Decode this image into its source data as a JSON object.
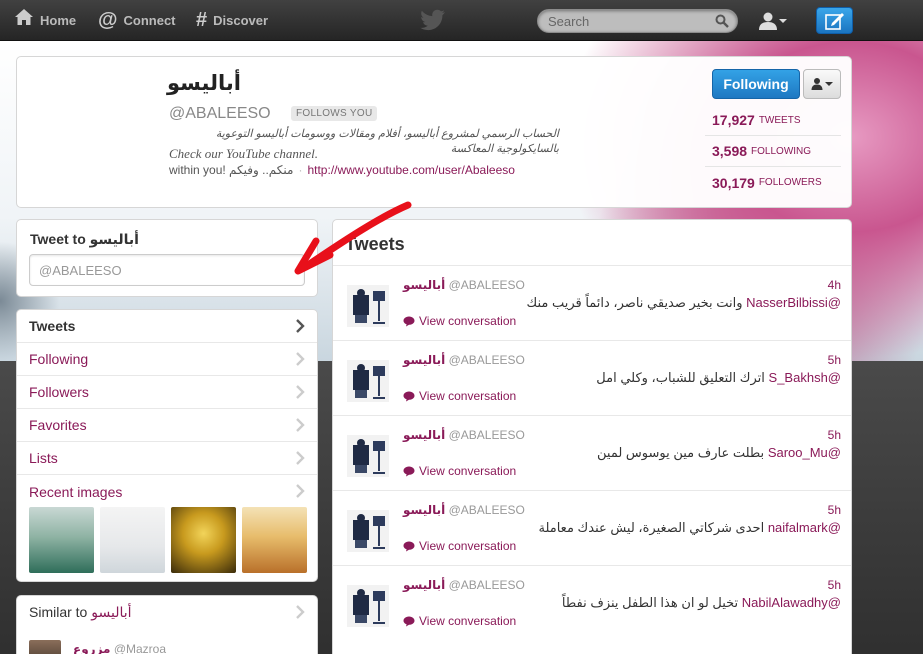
{
  "topbar": {
    "nav": [
      {
        "label": "Home",
        "icon": "home-icon"
      },
      {
        "label": "Connect",
        "icon": "at-icon"
      },
      {
        "label": "Discover",
        "icon": "hash-icon"
      }
    ],
    "search_placeholder": "Search"
  },
  "profile": {
    "name": "أباليسو",
    "handle": "@ABALEESO",
    "follows_you": "FOLLOWS YOU",
    "bio_arabic": "الحساب الرسمي لمشروع أباليسو، أفلام ومقالات ووسومات أباليسو التوعوية بالسايكولوجية المعاكسة",
    "bio_english": "Check our YouTube channel.",
    "location": "within you! منكم.. وفيكم",
    "url": "http://www.youtube.com/user/Abaleeso",
    "following_button": "Following",
    "stats": [
      {
        "num": "17,927",
        "label": "TWEETS"
      },
      {
        "num": "3,598",
        "label": "FOLLOWING"
      },
      {
        "num": "30,179",
        "label": "FOLLOWERS"
      }
    ]
  },
  "tweet_to": {
    "title": "Tweet to",
    "name": "أباليسو",
    "placeholder": "@ABALEESO"
  },
  "sidebar_nav": [
    {
      "label": "Tweets",
      "active": true
    },
    {
      "label": "Following",
      "active": false
    },
    {
      "label": "Followers",
      "active": false
    },
    {
      "label": "Favorites",
      "active": false
    },
    {
      "label": "Lists",
      "active": false
    },
    {
      "label": "Recent images",
      "active": false
    }
  ],
  "similar": {
    "title": "Similar to",
    "name": "أباليسو",
    "first_name": "مزروع",
    "first_handle": "@Mazroa"
  },
  "timeline": {
    "title": "Tweets",
    "view_conversation": "View conversation",
    "tweets": [
      {
        "name": "أباليسو",
        "handle": "@ABALEESO",
        "time": "4h",
        "mention": "@NasserBilbissi",
        "text": "وانت بخير صديقي ناصر، دائماً قريب منك"
      },
      {
        "name": "أباليسو",
        "handle": "@ABALEESO",
        "time": "5h",
        "mention": "@S_Bakhsh",
        "text": "اترك التعليق للشباب، وكلي امل"
      },
      {
        "name": "أباليسو",
        "handle": "@ABALEESO",
        "time": "5h",
        "mention": "@Saroo_Mu",
        "text": "بطلت عارف مين يوسوس لمين"
      },
      {
        "name": "أباليسو",
        "handle": "@ABALEESO",
        "time": "5h",
        "mention": "@naifalmark",
        "text": "احدى شركاتي الصغيرة، ليش عندك معاملة"
      },
      {
        "name": "أباليسو",
        "handle": "@ABALEESO",
        "time": "5h",
        "mention": "@NabilAlawadhy",
        "text": "تخيل لو ان هذا الطفل ينزف نفطاً"
      }
    ]
  },
  "colors": {
    "link": "#8a1a58",
    "primary_button": "#1e78c2"
  }
}
